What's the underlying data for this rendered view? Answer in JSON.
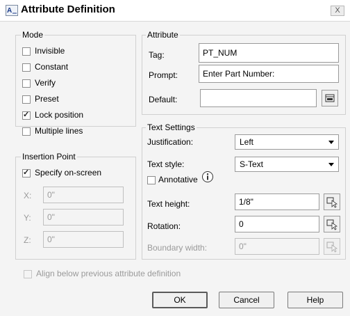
{
  "window": {
    "title": "Attribute Definition",
    "close_label": "X"
  },
  "mode": {
    "title": "Mode",
    "items": [
      {
        "label": "Invisible",
        "checked": false
      },
      {
        "label": "Constant",
        "checked": false
      },
      {
        "label": "Verify",
        "checked": false
      },
      {
        "label": "Preset",
        "checked": false
      },
      {
        "label": "Lock position",
        "checked": true
      },
      {
        "label": "Multiple lines",
        "checked": false
      }
    ]
  },
  "insertion": {
    "title": "Insertion Point",
    "specify_label": "Specify on-screen",
    "specify_checked": true,
    "x_label": "X:",
    "x_value": "0\"",
    "y_label": "Y:",
    "y_value": "0\"",
    "z_label": "Z:",
    "z_value": "0\""
  },
  "attribute": {
    "title": "Attribute",
    "tag_label": "Tag:",
    "tag_value": "PT_NUM",
    "prompt_label": "Prompt:",
    "prompt_value": "Enter Part Number:",
    "default_label": "Default:",
    "default_value": ""
  },
  "text_settings": {
    "title": "Text Settings",
    "justification_label": "Justification:",
    "justification_value": "Left",
    "style_label": "Text style:",
    "style_value": "S-Text",
    "annotative_label": "Annotative",
    "height_label": "Text height:",
    "height_value": "1/8\"",
    "rotation_label": "Rotation:",
    "rotation_value": "0",
    "boundary_label": "Boundary width:",
    "boundary_value": "0\""
  },
  "align_label": "Align below previous attribute definition",
  "buttons": {
    "ok": "OK",
    "cancel": "Cancel",
    "help": "Help"
  }
}
